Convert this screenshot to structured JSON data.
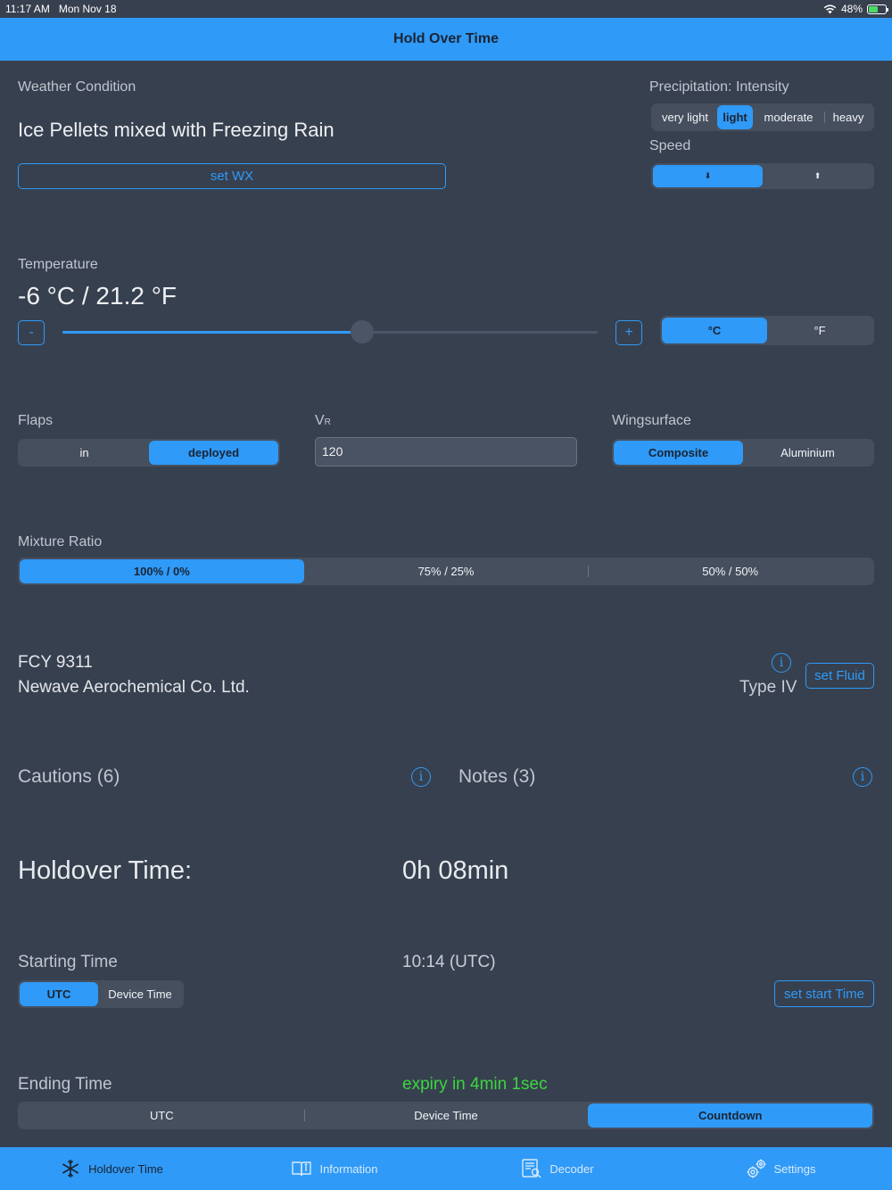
{
  "status_bar": {
    "time": "11:17 AM",
    "date": "Mon Nov 18",
    "battery": "48%",
    "battery_level": 0.48
  },
  "nav": {
    "title": "Hold Over Time"
  },
  "weather": {
    "label": "Weather Condition",
    "value": "Ice Pellets mixed with Freezing Rain",
    "set_button": "set WX"
  },
  "precip": {
    "label": "Precipitation: Intensity",
    "options": [
      "very light",
      "light",
      "moderate",
      "heavy"
    ],
    "selected": "light"
  },
  "speed": {
    "label": "Speed",
    "options": [
      "⬇",
      "⬆"
    ],
    "selected_index": 0
  },
  "temperature": {
    "label": "Temperature",
    "value": "-6 °C / 21.2 °F",
    "minus": "-",
    "plus": "+",
    "slider_fraction": 0.56,
    "units": [
      "°C",
      "°F"
    ],
    "selected_unit": "°C"
  },
  "flaps": {
    "label": "Flaps",
    "options": [
      "in",
      "deployed"
    ],
    "selected": "deployed"
  },
  "vr": {
    "label_main": "V",
    "label_sub": "R",
    "value": "120"
  },
  "wingsurface": {
    "label": "Wingsurface",
    "options": [
      "Composite",
      "Aluminium"
    ],
    "selected": "Composite"
  },
  "mixture": {
    "label": "Mixture Ratio",
    "options": [
      "100% / 0%",
      "75% / 25%",
      "50% / 50%"
    ],
    "selected": "100% / 0%"
  },
  "fluid": {
    "name": "FCY 9311",
    "manufacturer": "Newave Aerochemical Co. Ltd.",
    "type": "Type IV",
    "set_button": "set Fluid",
    "info_glyph": "i"
  },
  "cautions": {
    "label": "Cautions (6)"
  },
  "notes": {
    "label": "Notes (3)"
  },
  "holdover": {
    "label": "Holdover Time:",
    "value": "0h 08min"
  },
  "starting": {
    "label": "Starting Time",
    "value": "10:14 (UTC)",
    "options": [
      "UTC",
      "Device Time"
    ],
    "selected": "UTC",
    "set_button": "set start Time"
  },
  "ending": {
    "label": "Ending Time",
    "value": "expiry in 4min 1sec",
    "options": [
      "UTC",
      "Device Time",
      "Countdown"
    ],
    "selected": "Countdown"
  },
  "tabs": [
    {
      "label": "Holdover Time",
      "icon": "snowflake-icon",
      "selected": true
    },
    {
      "label": "Information",
      "icon": "book-icon",
      "selected": false
    },
    {
      "label": "Decoder",
      "icon": "decoder-icon",
      "selected": false
    },
    {
      "label": "Settings",
      "icon": "gear-icon",
      "selected": false
    }
  ],
  "colors": {
    "accent": "#2f9af7",
    "background": "#37404f",
    "expiry": "#3cd640"
  }
}
